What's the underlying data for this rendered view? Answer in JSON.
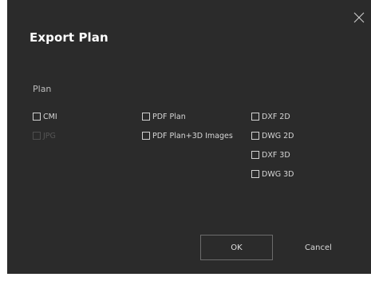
{
  "dialog": {
    "title": "Export Plan",
    "close_icon": "close-icon",
    "section_label": "Plan"
  },
  "options": {
    "cmi": {
      "label": "CMI",
      "checked": false,
      "enabled": true
    },
    "jpg": {
      "label": "JPG",
      "checked": false,
      "enabled": false
    },
    "pdf_plan": {
      "label": "PDF Plan",
      "checked": false,
      "enabled": true
    },
    "pdf_plan_3d": {
      "label": "PDF Plan+3D Images",
      "checked": false,
      "enabled": true
    },
    "dxf_2d": {
      "label": "DXF 2D",
      "checked": false,
      "enabled": true
    },
    "dwg_2d": {
      "label": "DWG 2D",
      "checked": false,
      "enabled": true
    },
    "dxf_3d": {
      "label": "DXF 3D",
      "checked": false,
      "enabled": true
    },
    "dwg_3d": {
      "label": "DWG 3D",
      "checked": false,
      "enabled": true
    }
  },
  "buttons": {
    "ok_label": "OK",
    "cancel_label": "Cancel"
  },
  "colors": {
    "dialog_background": "#2b2b2b",
    "text": "#d6d6d6",
    "disabled_text": "#555555"
  }
}
